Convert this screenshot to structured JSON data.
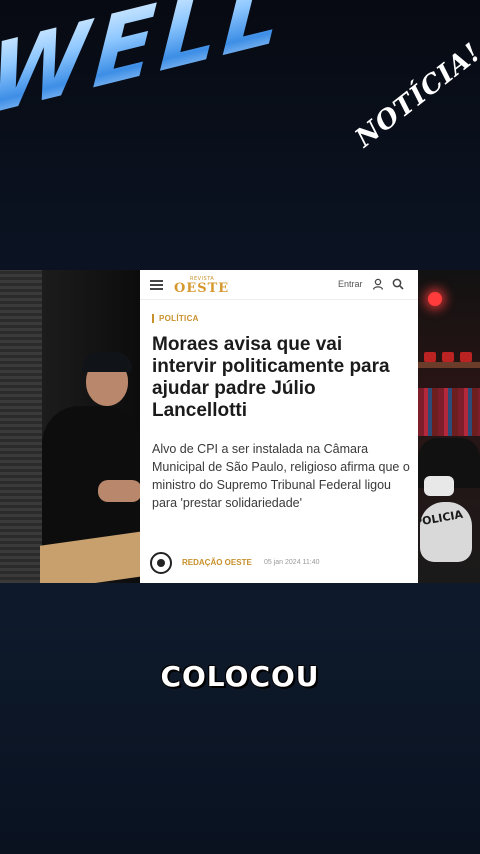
{
  "brand": {
    "title": "WELL",
    "subtitle": "NOTÍCIA!"
  },
  "video": {
    "scene_text": "POLICIA",
    "article": {
      "logo_small": "REVISTA",
      "logo": "OESTE",
      "login_label": "Entrar",
      "category": "POLÍTICA",
      "headline": "Moraes avisa que vai intervir politicamente para ajudar padre Júlio Lancellotti",
      "lede": "Alvo de CPI a ser instalada na Câmara Municipal de São Paulo, religioso afirma que o ministro do Supremo Tribunal Federal ligou para 'prestar solidariedade'",
      "author": "REDAÇÃO OESTE",
      "date": "05 jan 2024 11:40"
    }
  },
  "caption": "COLOCOU",
  "colors": {
    "accent": "#c8902b",
    "brand_blue": "#8fc8ff",
    "background": "#0b1322"
  },
  "icons": [
    "menu-icon",
    "user-icon",
    "search-icon"
  ]
}
